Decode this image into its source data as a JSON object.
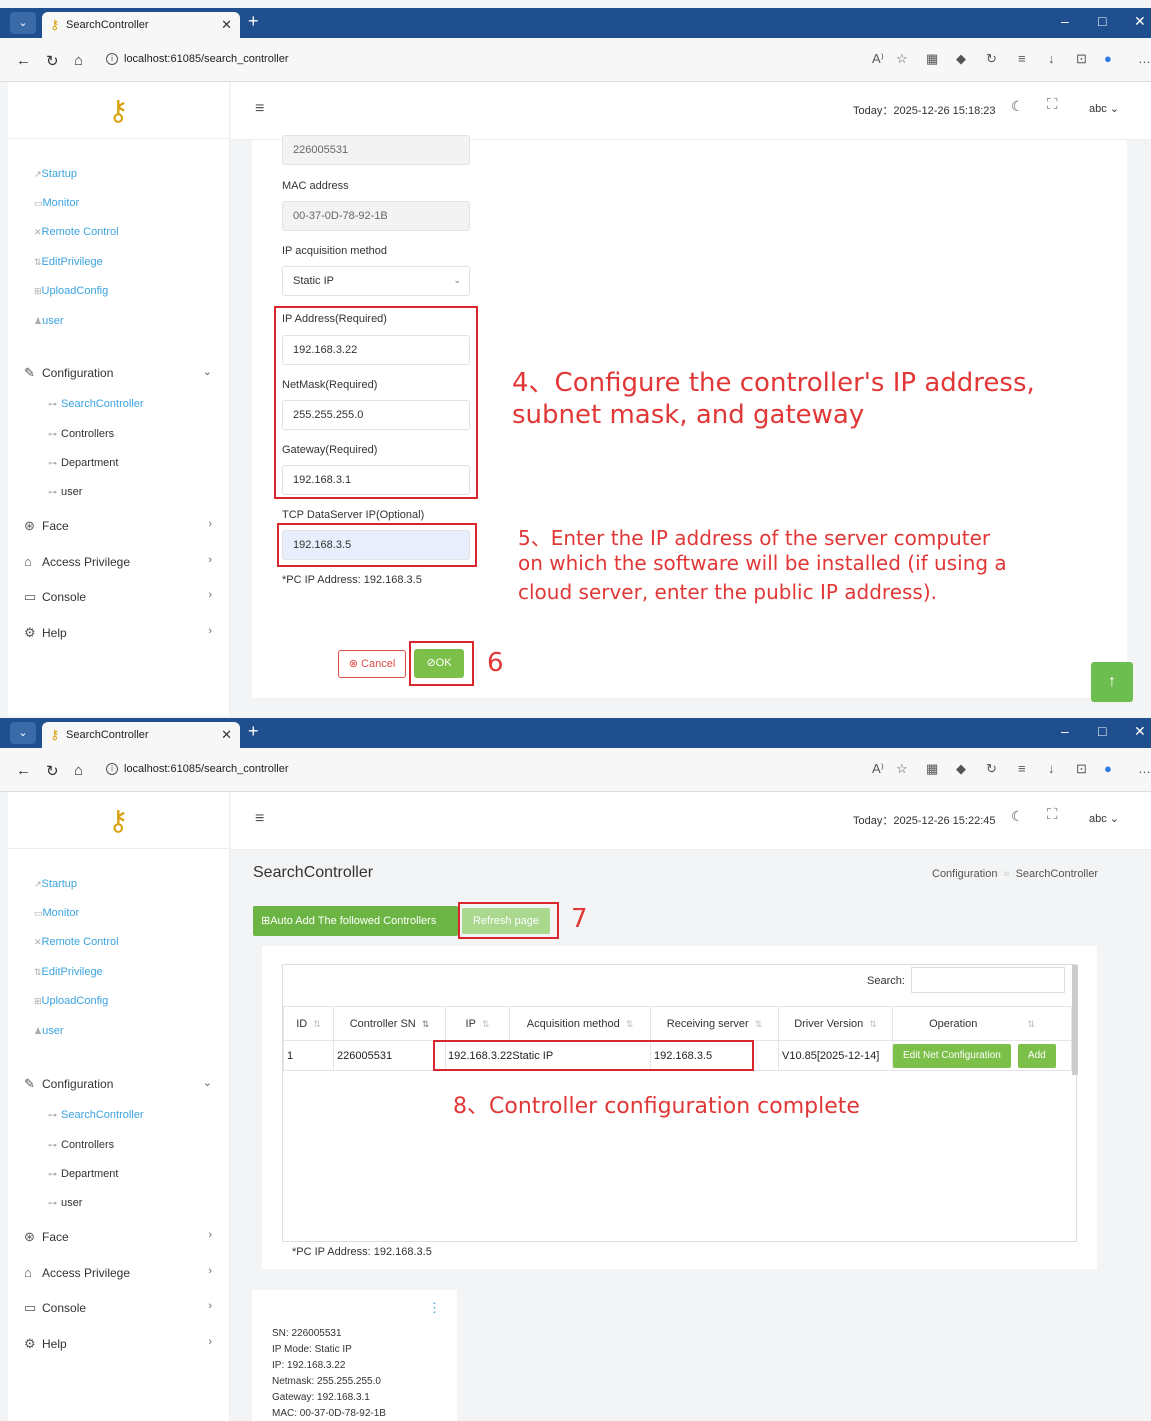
{
  "browser": {
    "tab_title": "SearchController",
    "url": "localhost:61085/search_controller",
    "aa_icon": "A⁾",
    "window_controls": [
      "–",
      "□",
      "✕"
    ]
  },
  "sidebar": {
    "quick_links": [
      "Startup",
      "Monitor",
      "Remote Control",
      "EditPrivilege",
      "UploadConfig",
      "user"
    ],
    "menu": [
      {
        "label": "Configuration",
        "icon": "edit-icon",
        "expanded": true
      },
      {
        "label": "Face",
        "icon": "face-icon"
      },
      {
        "label": "Access Privilege",
        "icon": "home-icon"
      },
      {
        "label": "Console",
        "icon": "console-icon"
      },
      {
        "label": "Help",
        "icon": "gear-icon"
      }
    ],
    "submenu": [
      "SearchController",
      "Controllers",
      "Department",
      "user"
    ],
    "active_submenu": "SearchController"
  },
  "header1": {
    "today": "Today：2025-12-26 15:18:23",
    "user": "abc"
  },
  "header2": {
    "today": "Today：2025-12-26 15:22:45",
    "user": "abc"
  },
  "form": {
    "sn_value": "226005531",
    "mac_label": "MAC address",
    "mac_value": "00-37-0D-78-92-1B",
    "ip_method_label": "IP acquisition method",
    "ip_method_value": "Static IP",
    "ip_label": "IP Address(Required)",
    "ip_value": "192.168.3.22",
    "netmask_label": "NetMask(Required)",
    "netmask_value": "255.255.255.0",
    "gateway_label": "Gateway(Required)",
    "gateway_value": "192.168.3.1",
    "tcp_label": "TCP DataServer IP(Optional)",
    "tcp_value": "192.168.3.5",
    "pc_ip_note": "*PC IP Address: 192.168.3.5",
    "cancel_label": "Cancel",
    "ok_label": "OK"
  },
  "annotations": {
    "step4_line1": "4、Configure the controller's IP address,",
    "step4_line2": "subnet mask, and gateway",
    "step5_line1": "5、Enter the IP address of the server computer",
    "step5_line2": "on which the software will be installed (if using a",
    "step5_line3": "cloud server, enter the public IP address).",
    "step6": "6",
    "step7": "7",
    "step8": "8、Controller configuration complete"
  },
  "page2": {
    "title": "SearchController",
    "breadcrumb": [
      "Configuration",
      "SearchController"
    ],
    "auto_add_label": "Auto Add The followed Controllers",
    "refresh_label": "Refresh page",
    "search_label": "Search:",
    "columns": [
      "ID",
      "Controller SN",
      "IP",
      "Acquisition method",
      "Receiving server",
      "Driver Version",
      "Operation"
    ],
    "rows": [
      {
        "id": "1",
        "sn": "226005531",
        "ip": "192.168.3.22",
        "method": "Static IP",
        "server": "192.168.3.5",
        "version": "V10.85[2025-12-14]",
        "edit_label": "Edit Net Configuration",
        "add_label": "Add"
      }
    ],
    "pc_ip_note": "*PC IP Address: 192.168.3.5",
    "info_card": {
      "sn": "SN: 226005531",
      "mode": "IP Mode: Static IP",
      "ip": "IP: 192.168.3.22",
      "netmask": "Netmask: 255.255.255.0",
      "gateway": "Gateway: 192.168.3.1",
      "mac": "MAC: 00-37-0D-78-92-1B"
    }
  },
  "colors": {
    "accent_green": "#6cb544",
    "link_blue": "#3ba3e0",
    "annotation_red": "#e23737",
    "titlebar": "#1f4f8f"
  }
}
